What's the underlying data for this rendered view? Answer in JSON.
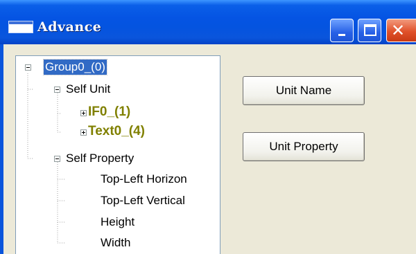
{
  "window": {
    "title": "Advance"
  },
  "tree": {
    "root": {
      "label": "Group0_(0)",
      "selected": true
    },
    "nodes": [
      {
        "label": "Self Unit"
      },
      {
        "label": "IF0_(1)"
      },
      {
        "label": "Text0_(4)"
      },
      {
        "label": "Self Property"
      },
      {
        "label": "Top-Left Horizon"
      },
      {
        "label": "Top-Left Vertical"
      },
      {
        "label": "Height"
      },
      {
        "label": "Width"
      }
    ]
  },
  "buttons": {
    "unit_name": "Unit Name",
    "unit_property": "Unit Property"
  },
  "colors": {
    "title_bar": "#0554e3",
    "selection": "#316ac5",
    "child_unit_text": "#808000"
  }
}
